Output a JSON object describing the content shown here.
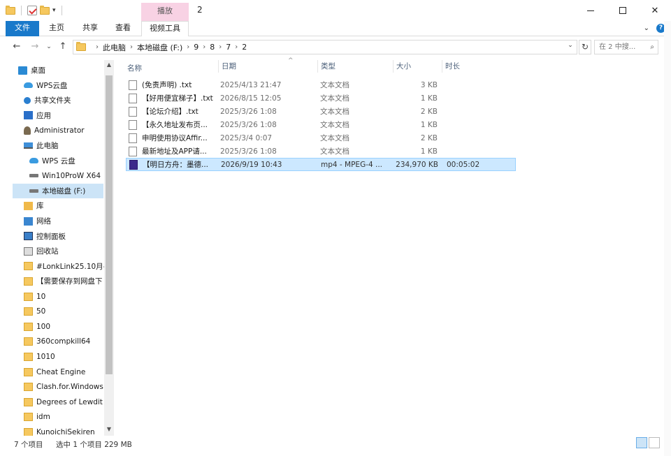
{
  "titlebar": {
    "window_title": "2",
    "context_tab_group": "播放",
    "controls": [
      "minimize",
      "maximize",
      "close"
    ]
  },
  "ribbon": {
    "tabs": [
      "文件",
      "主页",
      "共享",
      "查看",
      "视频工具"
    ],
    "help_label": "?"
  },
  "address": {
    "crumbs": [
      "此电脑",
      "本地磁盘 (F:)",
      "9",
      "8",
      "7",
      "2"
    ],
    "search_placeholder": "在 2 中搜..."
  },
  "nav": {
    "items": [
      {
        "label": "桌面",
        "icon": "desktop-icon"
      },
      {
        "label": "WPS云盘",
        "icon": "cloud-icon"
      },
      {
        "label": "共享文件夹",
        "icon": "share-icon"
      },
      {
        "label": "应用",
        "icon": "apps-icon"
      },
      {
        "label": "Administrator",
        "icon": "user-icon"
      },
      {
        "label": "此电脑",
        "icon": "pc-icon"
      },
      {
        "label": "WPS 云盘",
        "icon": "cloud-icon"
      },
      {
        "label": "Win10ProW X64",
        "icon": "drive-icon"
      },
      {
        "label": "本地磁盘 (F:)",
        "icon": "drive-icon"
      },
      {
        "label": "库",
        "icon": "library-icon"
      },
      {
        "label": "网络",
        "icon": "network-icon"
      },
      {
        "label": "控制面板",
        "icon": "control-panel-icon"
      },
      {
        "label": "回收站",
        "icon": "recycle-bin-icon"
      },
      {
        "label": "#LonkLink25.10月-",
        "icon": "folder-icon"
      },
      {
        "label": "【需要保存到网盘下",
        "icon": "folder-icon"
      },
      {
        "label": "10",
        "icon": "folder-icon"
      },
      {
        "label": "50",
        "icon": "folder-icon"
      },
      {
        "label": "100",
        "icon": "folder-icon"
      },
      {
        "label": "360compkill64",
        "icon": "folder-icon"
      },
      {
        "label": "1010",
        "icon": "folder-icon"
      },
      {
        "label": "Cheat Engine",
        "icon": "folder-icon"
      },
      {
        "label": "Clash.for.Windows",
        "icon": "folder-icon"
      },
      {
        "label": "Degrees of Lewdit",
        "icon": "folder-icon"
      },
      {
        "label": "idm",
        "icon": "folder-icon"
      },
      {
        "label": "KunoichiSekiren",
        "icon": "folder-icon"
      }
    ],
    "selected_index": 8
  },
  "columns": {
    "name": "名称",
    "date": "日期",
    "type": "类型",
    "size": "大小",
    "duration": "时长"
  },
  "files": [
    {
      "name": "(免责声明) .txt",
      "date": "2025/4/13 21:47",
      "type": "文本文档",
      "size": "3 KB",
      "duration": "",
      "icon": "text-file-icon"
    },
    {
      "name": "【好用便宜梯子】.txt",
      "date": "2026/8/15 12:05",
      "type": "文本文档",
      "size": "1 KB",
      "duration": "",
      "icon": "text-file-icon"
    },
    {
      "name": "【论坛介绍】.txt",
      "date": "2025/3/26 1:08",
      "type": "文本文档",
      "size": "2 KB",
      "duration": "",
      "icon": "text-file-icon"
    },
    {
      "name": "【永久地址发布页...",
      "date": "2025/3/26 1:08",
      "type": "文本文档",
      "size": "1 KB",
      "duration": "",
      "icon": "text-file-icon"
    },
    {
      "name": "申明使用协议Affir...",
      "date": "2025/3/4 0:07",
      "type": "文本文档",
      "size": "2 KB",
      "duration": "",
      "icon": "text-file-icon"
    },
    {
      "name": "最新地址及APP请...",
      "date": "2025/3/26 1:08",
      "type": "文本文档",
      "size": "1 KB",
      "duration": "",
      "icon": "text-file-icon"
    },
    {
      "name": "【明日方舟：墨德...",
      "date": "2026/9/19 10:43",
      "type": "mp4 - MPEG-4 ...",
      "size": "234,970 KB",
      "duration": "00:05:02",
      "icon": "video-file-icon"
    }
  ],
  "selected_file_index": 6,
  "status": {
    "item_count": "7 个项目",
    "selection": "选中 1 个项目  229 MB"
  }
}
